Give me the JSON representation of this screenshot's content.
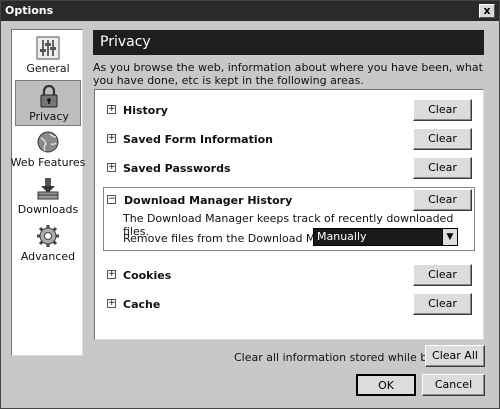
{
  "window": {
    "title": "Options",
    "close_glyph": "x"
  },
  "categories": [
    {
      "label": "General",
      "icon": "sliders-icon",
      "selected": false
    },
    {
      "label": "Privacy",
      "icon": "padlock-icon",
      "selected": true
    },
    {
      "label": "Web Features",
      "icon": "globe-icon",
      "selected": false
    },
    {
      "label": "Downloads",
      "icon": "download-tray-icon",
      "selected": false
    },
    {
      "label": "Advanced",
      "icon": "gear-icon",
      "selected": false
    }
  ],
  "privacy": {
    "header": "Privacy",
    "intro": "As you browse the web, information about where you have been, what you have done, etc is kept in the following areas.",
    "items": [
      {
        "label": "History",
        "button": "Clear",
        "expanded": false
      },
      {
        "label": "Saved Form Information",
        "button": "Clear",
        "expanded": false
      },
      {
        "label": "Saved Passwords",
        "button": "Clear",
        "expanded": false
      },
      {
        "label": "Download Manager History",
        "button": "Clear",
        "expanded": true,
        "description": "The Download Manager keeps track of recently downloaded files.",
        "remove_label": "Remove files from the Download Manager:",
        "remove_value": "Manually"
      },
      {
        "label": "Cookies",
        "button": "Clear",
        "expanded": false
      },
      {
        "label": "Cache",
        "button": "Clear",
        "expanded": false
      }
    ],
    "expand_glyph": "+",
    "collapse_glyph": "−"
  },
  "footer": {
    "clear_all_label": "Clear all information stored while browsing:",
    "clear_all_button": "Clear All",
    "ok_button": "OK",
    "cancel_button": "Cancel"
  }
}
